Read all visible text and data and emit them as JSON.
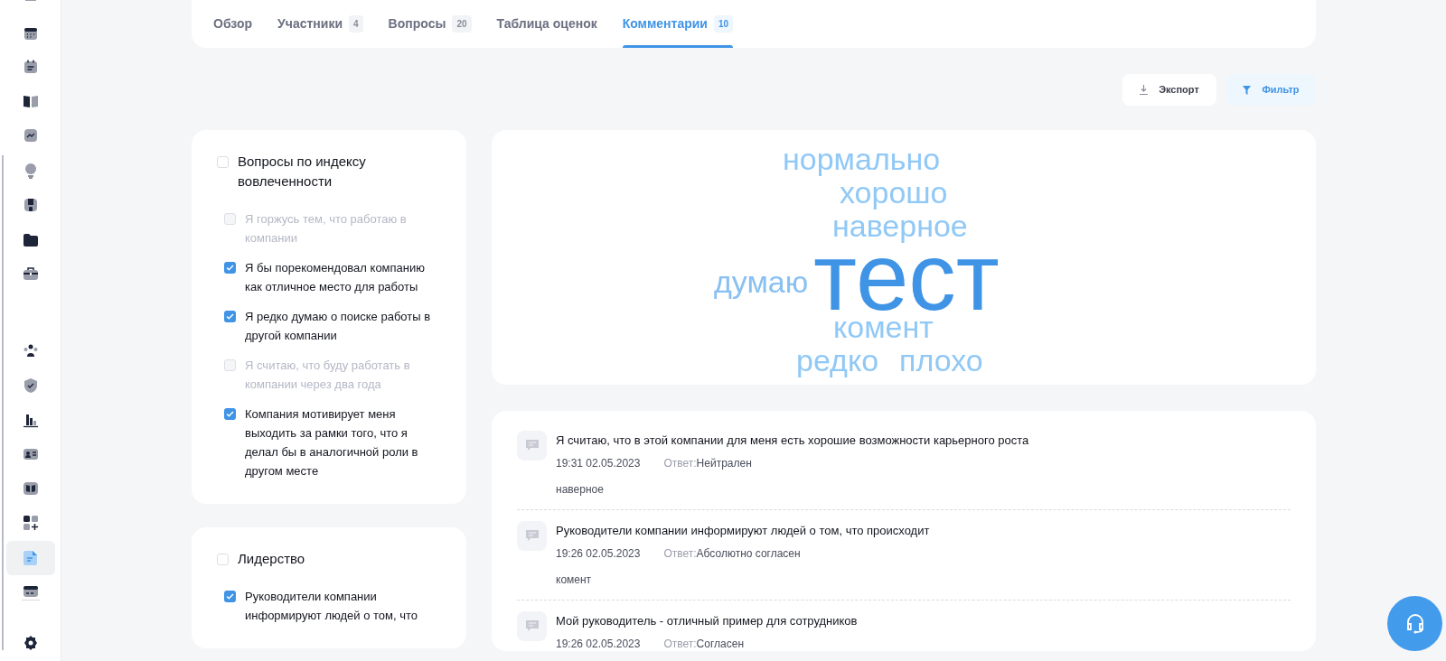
{
  "sidebar": {
    "items": [
      {
        "selected": false
      },
      {
        "selected": false
      },
      {
        "selected": false
      },
      {
        "selected": false
      },
      {
        "selected": false
      },
      {
        "selected": false
      },
      {
        "selected": false
      },
      {
        "selected": false
      },
      {
        "selected": false
      },
      {
        "selected": false
      },
      {
        "selected": false
      },
      {
        "selected": false
      },
      {
        "selected": false
      },
      {
        "selected": false
      },
      {
        "selected": false
      },
      {
        "selected": true
      },
      {
        "selected": false
      },
      {
        "selected": false
      }
    ]
  },
  "tabs": [
    {
      "label": "Обзор",
      "selected": false
    },
    {
      "label": "Участники",
      "count": "4",
      "selected": false
    },
    {
      "label": "Вопросы",
      "count": "20",
      "selected": false
    },
    {
      "label": "Таблица оценок",
      "selected": false
    },
    {
      "label": "Комментарии",
      "count": "10",
      "selected": true
    }
  ],
  "toolbar": {
    "export": "Экспорт",
    "filter": "Фильтр"
  },
  "question_groups": [
    {
      "title": "Вопросы по индексу вовлеченности",
      "checked": false,
      "items": [
        {
          "text": "Я горжусь тем, что работаю в компании",
          "checked": false
        },
        {
          "text": "Я бы порекомендовал компанию как отличное место для работы",
          "checked": true
        },
        {
          "text": "Я редко думаю о поиске работы в другой компании",
          "checked": true
        },
        {
          "text": "Я считаю, что буду работать в компании через два года",
          "checked": false
        },
        {
          "text": "Компания мотивирует меня выходить за рамки того, что я делал бы в аналогичной роли в другом месте",
          "checked": true
        }
      ]
    },
    {
      "title": "Лидерство",
      "checked": false,
      "items": [
        {
          "text": "Руководители компании информируют людей о том, что",
          "checked": true
        }
      ]
    }
  ],
  "word_cloud": [
    {
      "word": "нормально",
      "color": "#90c8f6"
    },
    {
      "word": "хорошо",
      "color": "#90c8f6"
    },
    {
      "word": "наверное",
      "color": "#90c8f6"
    },
    {
      "word": "думаю",
      "color": "#88c0f2"
    },
    {
      "word": "тест",
      "color": "#3f94e6"
    },
    {
      "word": "комент",
      "color": "#90c8f6"
    },
    {
      "word": "редко",
      "color": "#90c8f6"
    },
    {
      "word": "плохо",
      "color": "#90c8f6"
    }
  ],
  "comments": [
    {
      "question": "Я считаю, что в этой компании для меня есть хорошие возможности карьерного роста",
      "time": "19:31 02.05.2023",
      "answer_label": "Ответ:",
      "answer": "Нейтрален",
      "text": "наверное"
    },
    {
      "question": "Руководители компании информируют людей о том, что происходит",
      "time": "19:26 02.05.2023",
      "answer_label": "Ответ:",
      "answer": "Абсолютно согласен",
      "text": "комент"
    },
    {
      "question": "Мой руководитель - отличный пример для сотрудников",
      "time": "19:26 02.05.2023",
      "answer_label": "Ответ:",
      "answer": "Согласен"
    }
  ]
}
